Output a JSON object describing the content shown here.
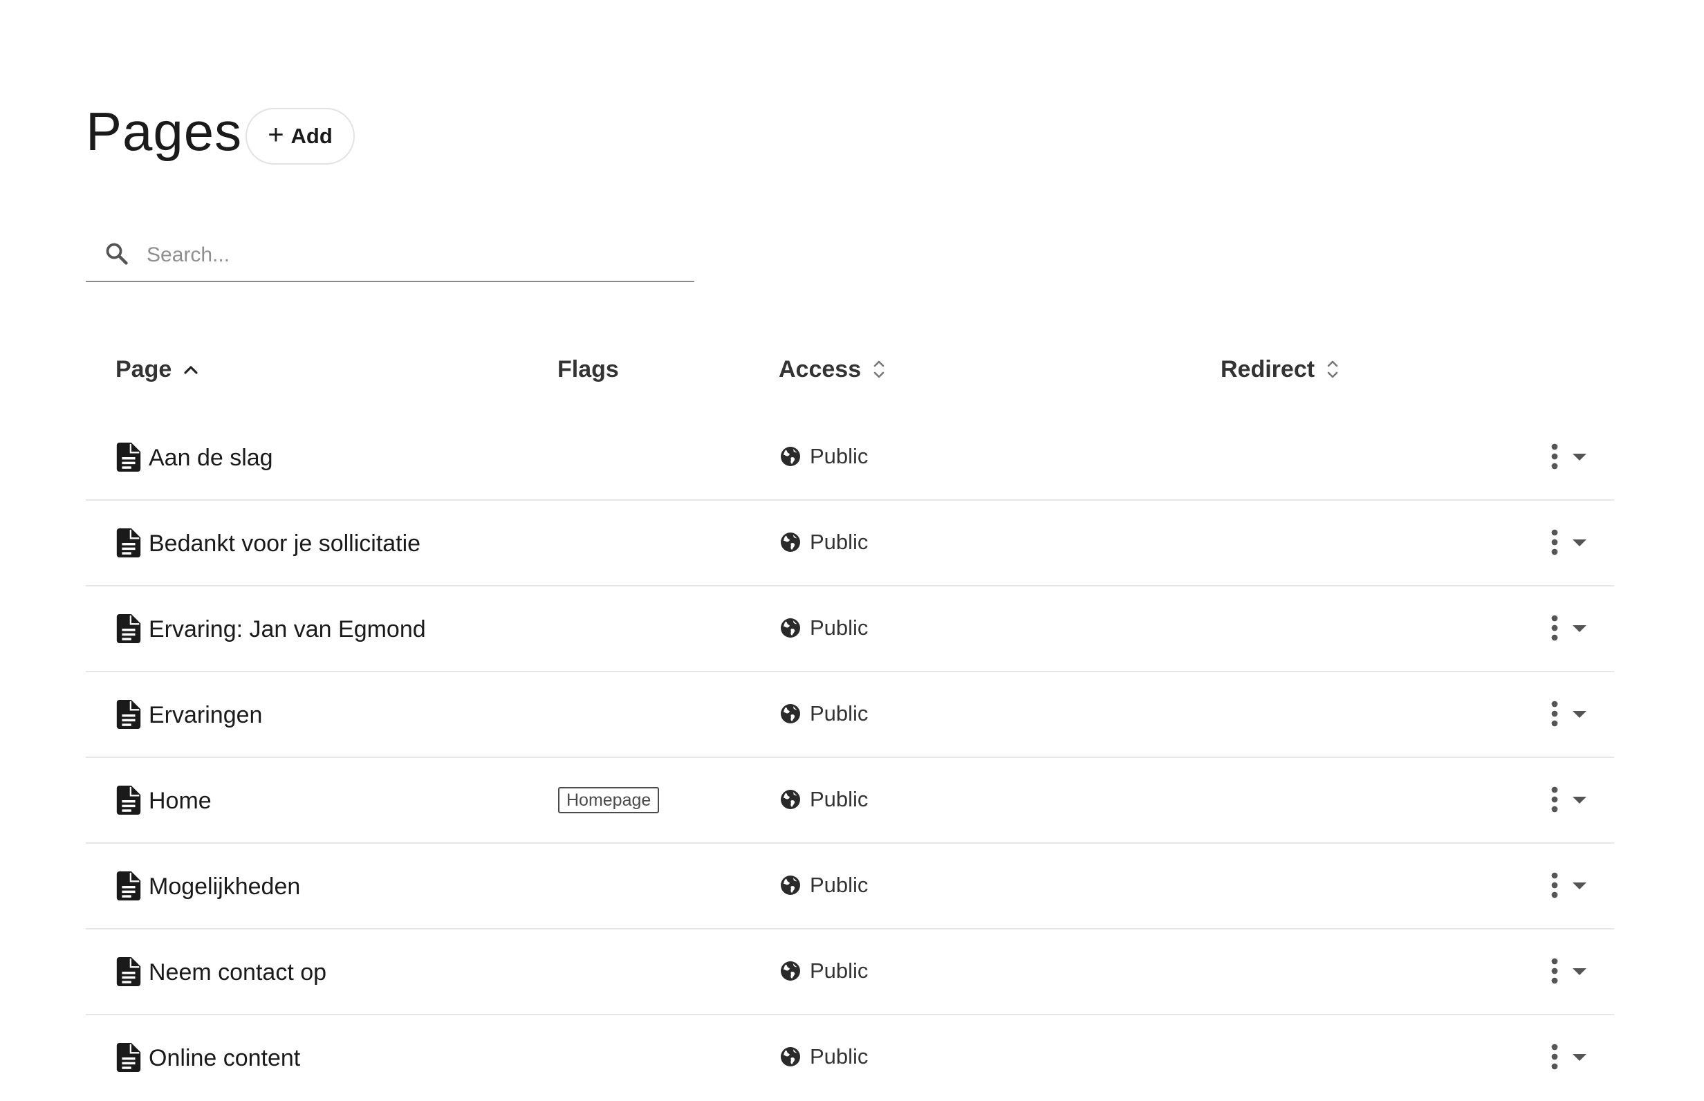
{
  "header": {
    "title": "Pages",
    "add_label": "Add"
  },
  "search": {
    "placeholder": "Search..."
  },
  "table": {
    "columns": {
      "page": "Page",
      "flags": "Flags",
      "access": "Access",
      "redirect": "Redirect"
    },
    "sort": {
      "column": "Page",
      "direction": "ascending"
    },
    "rows": [
      {
        "name": "Aan de slag",
        "flag": "",
        "access": "Public"
      },
      {
        "name": "Bedankt voor je sollicitatie",
        "flag": "",
        "access": "Public"
      },
      {
        "name": "Ervaring: Jan van Egmond",
        "flag": "",
        "access": "Public"
      },
      {
        "name": "Ervaringen",
        "flag": "",
        "access": "Public"
      },
      {
        "name": "Home",
        "flag": "Homepage",
        "access": "Public"
      },
      {
        "name": "Mogelijkheden",
        "flag": "",
        "access": "Public"
      },
      {
        "name": "Neem contact op",
        "flag": "",
        "access": "Public"
      },
      {
        "name": "Online content",
        "flag": "",
        "access": "Public"
      }
    ]
  },
  "icons": {
    "add": "plus-icon",
    "search": "search-icon",
    "page": "document-icon",
    "access": "globe-icon",
    "row_menu": "more-vertical-icon",
    "row_expand": "chevron-down-icon",
    "sort_asc": "chevron-up-icon",
    "sortable": "sort-icon"
  },
  "colors": {
    "text": "#1a1a1a",
    "muted": "#8f8f8f",
    "divider": "#e6e6e6"
  }
}
